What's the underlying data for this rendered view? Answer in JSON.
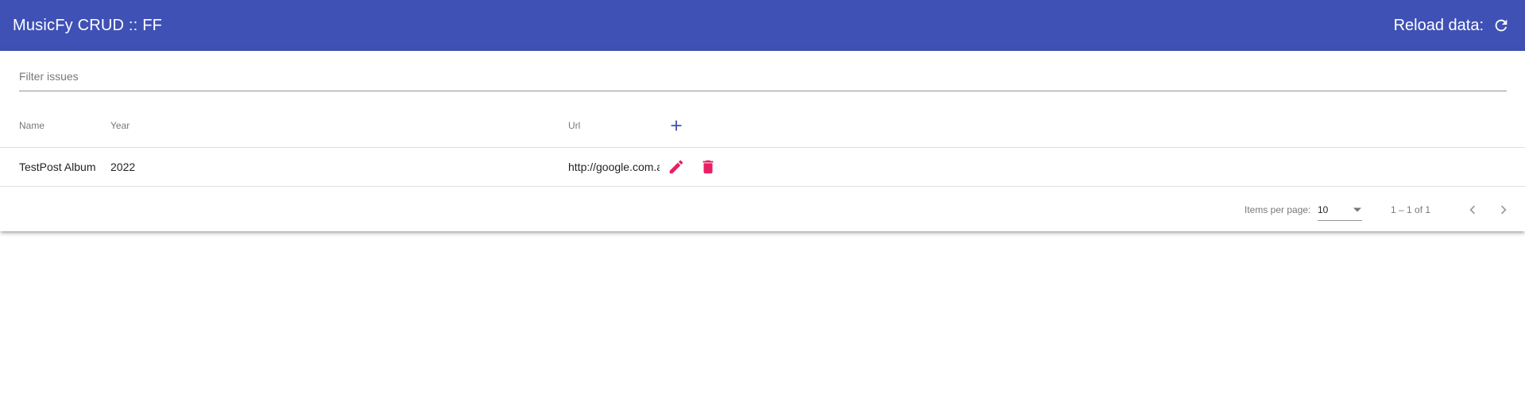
{
  "toolbar": {
    "title": "MusicFy CRUD :: FF",
    "reload_label": "Reload data:",
    "reload_icon": "refresh-icon"
  },
  "filter": {
    "placeholder": "Filter issues",
    "value": ""
  },
  "table": {
    "columns": [
      "Name",
      "Year",
      "Url"
    ],
    "add_icon": "plus-icon",
    "rows": [
      {
        "name": "TestPost Album",
        "year": "2022",
        "url": "http://google.com.ar",
        "edit_icon": "pencil-icon",
        "delete_icon": "trash-icon"
      }
    ]
  },
  "paginator": {
    "items_per_page_label": "Items per page:",
    "page_size": "10",
    "range_label": "1 – 1 of 1",
    "prev_icon": "chevron-left-icon",
    "next_icon": "chevron-right-icon"
  },
  "colors": {
    "primary": "#3f51b5",
    "accent": "#e91e63"
  }
}
